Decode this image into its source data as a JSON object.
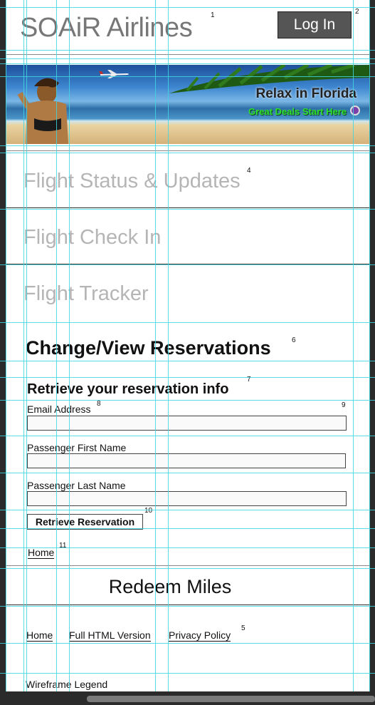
{
  "header": {
    "title": "SOAiR Airlines",
    "login_label": "Log In"
  },
  "banner": {
    "title": "Relax in Florida",
    "subtitle": "Great Deals Start Here"
  },
  "nav": {
    "items": [
      {
        "label": "Flight Status & Updates"
      },
      {
        "label": "Flight Check In"
      },
      {
        "label": "Flight Tracker"
      }
    ]
  },
  "reservations": {
    "heading": "Change/View Reservations",
    "subheading": "Retrieve your reservation info",
    "email_label": "Email Address",
    "email_value": "",
    "first_name_label": "Passenger First Name",
    "first_name_value": "",
    "last_name_label": "Passenger Last Name",
    "last_name_value": "",
    "retrieve_label": "Retrieve Reservation",
    "home_link": "Home"
  },
  "redeem": {
    "label": "Redeem Miles"
  },
  "footer": {
    "home": "Home",
    "full_html": "Full HTML Version",
    "privacy": "Privacy Policy",
    "legend": "Wireframe Legend"
  },
  "notes": {
    "n1": "1",
    "n2": "2",
    "n4": "4",
    "n5": "5",
    "n6": "6",
    "n7": "7",
    "n8": "8",
    "n9": "9",
    "n10": "10",
    "n11": "11"
  },
  "colors": {
    "page_background": "#2b2b2b",
    "guide_line": "#3fd6e0",
    "nav_text": "#b5b5b5",
    "banner_subtitle": "#2fe02f",
    "login_button": "#555555"
  },
  "icons": {
    "banner_arrow": "circle-arrow-icon",
    "airplane": "airplane-icon"
  }
}
